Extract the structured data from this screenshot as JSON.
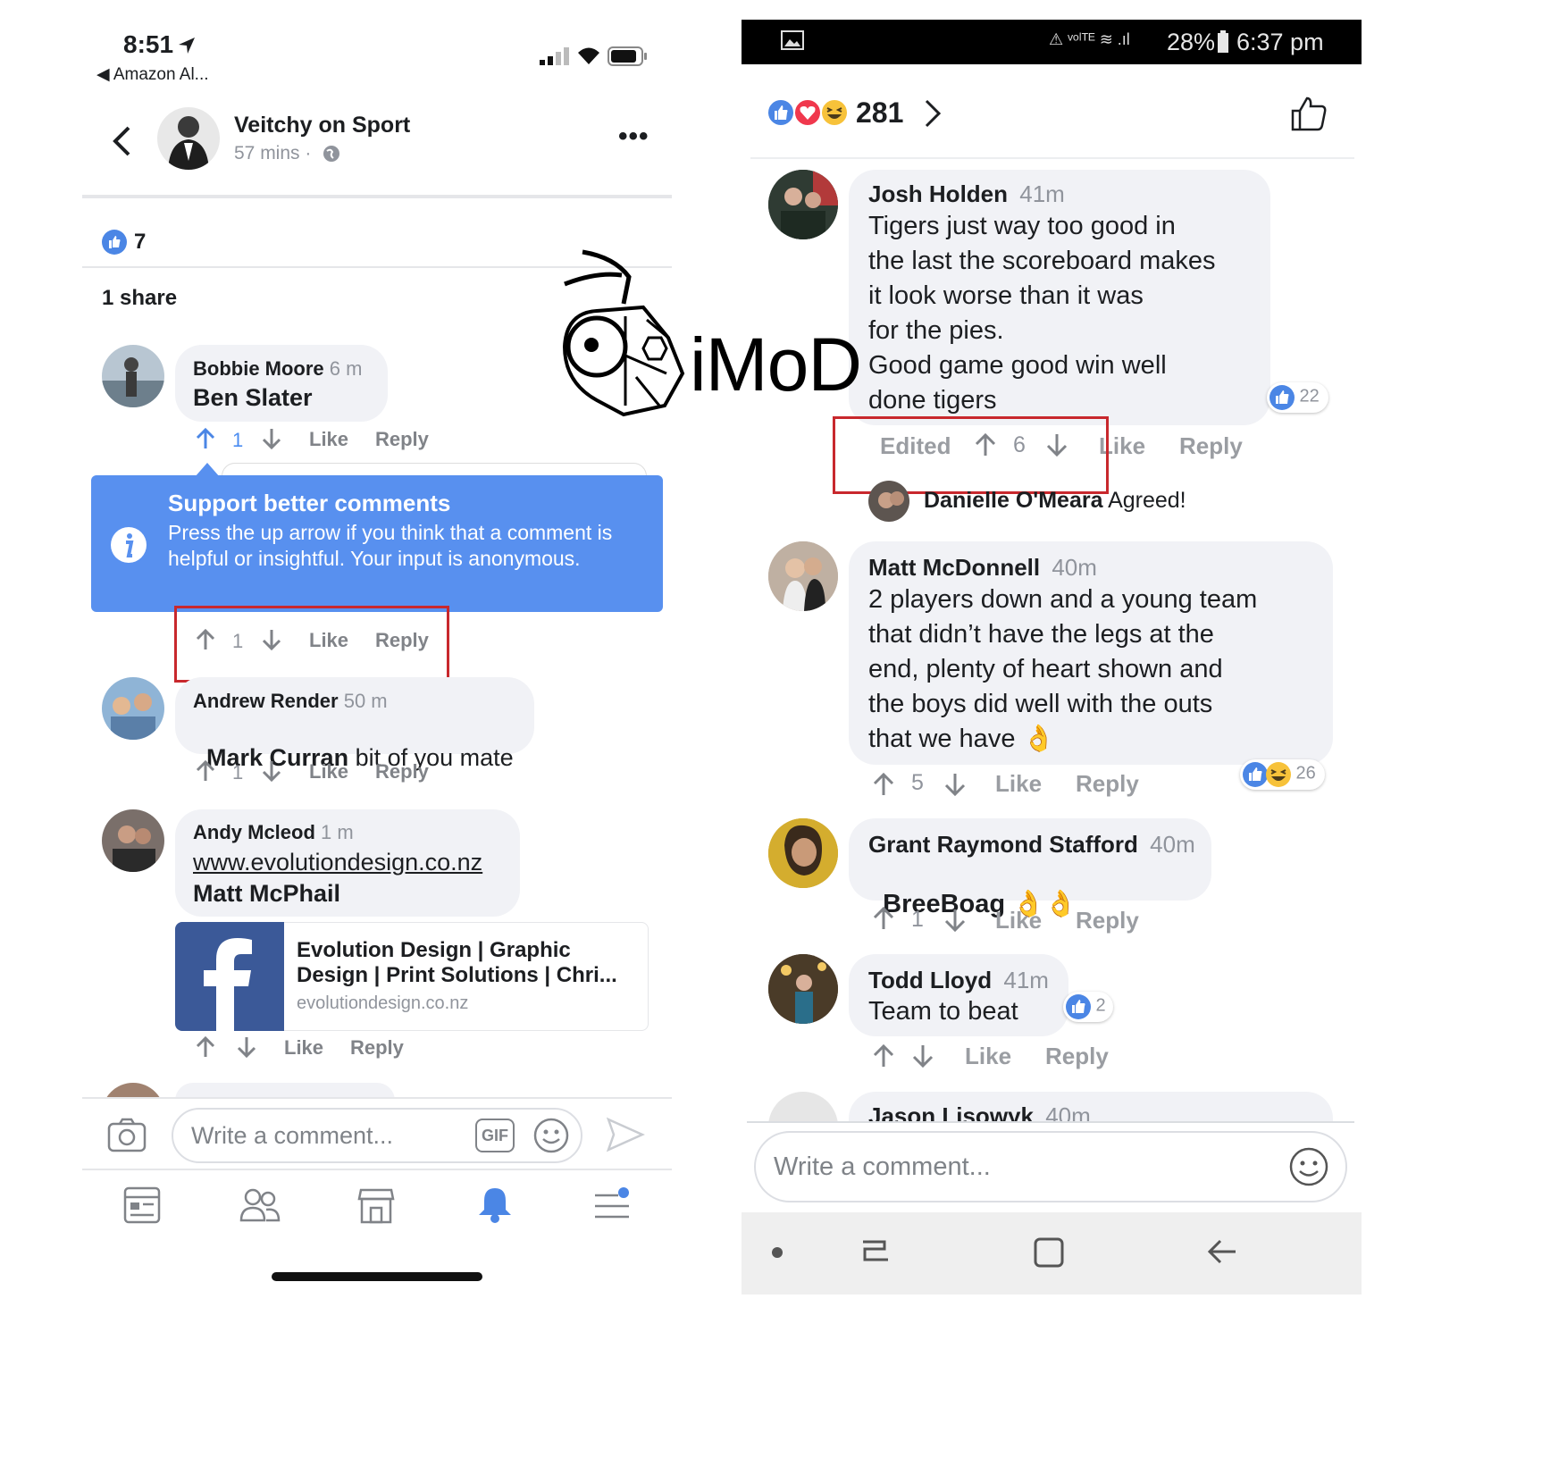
{
  "left": {
    "status": {
      "time": "8:51",
      "back_app": "Amazon Al..."
    },
    "post": {
      "name": "Veitchy on Sport",
      "meta": "57 mins ·"
    },
    "reactions_count": "7",
    "share_text": "1 share",
    "comments": [
      {
        "name": "Bobbie Moore",
        "time": "6 m",
        "text": "Ben Slater",
        "votes": "1"
      },
      {
        "votes": "1"
      },
      {
        "name": "Andrew Render",
        "time": "50 m",
        "mention": "Mark Curran",
        "text": " bit of you mate",
        "votes": "1"
      },
      {
        "name": "Andy Mcleod",
        "time": "1 m",
        "link": "www.evolutiondesign.co.nz",
        "text": "Matt McPhail"
      }
    ],
    "link_card": {
      "title": "Evolution Design | Graphic Design | Print Solutions | Chri...",
      "domain": "evolutiondesign.co.nz"
    },
    "tooltip": {
      "title": "Support better comments",
      "body": "Press the up arrow if you think that a comment is helpful or insightful. Your input is anonymous."
    },
    "actions": {
      "like": "Like",
      "reply": "Reply"
    },
    "composer": {
      "placeholder": "Write a comment...",
      "gif": "GIF"
    }
  },
  "right": {
    "status": {
      "battery": "28%",
      "time": "6:37 pm"
    },
    "reactions_total": "281",
    "comments": [
      {
        "name": "Josh Holden",
        "time": "41m",
        "text_lines": [
          "Tigers just way too good in",
          "the last the scoreboard makes",
          "it look worse than it was",
          "for the pies.",
          "Good game good win well",
          "done tigers"
        ],
        "reactions": "22",
        "edited": "Edited",
        "votes": "6"
      },
      {
        "name": "Matt McDonnell",
        "time": "40m",
        "text_lines": [
          "2 players down and a young team",
          "that didn’t have the legs at the",
          "end, plenty of heart shown and",
          "the boys did well with the outs",
          "that we have 👌"
        ],
        "reactions": "26",
        "votes": "5"
      },
      {
        "name": "Grant Raymond Stafford",
        "time": "40m",
        "mention": "BreeBoag",
        "emoji": "👌👌",
        "votes": "1"
      },
      {
        "name": "Todd Lloyd",
        "time": "41m",
        "text": "Team to beat",
        "reactions": "2"
      },
      {
        "name": "Jason Lisowyk",
        "time": "40m"
      }
    ],
    "reply_preview": {
      "name": "Danielle O'Meara",
      "text": "Agreed!"
    },
    "actions": {
      "like": "Like",
      "reply": "Reply"
    },
    "composer": {
      "placeholder": "Write a comment..."
    }
  },
  "watermark": {
    "text": "iMoD"
  },
  "colors": {
    "accent_blue": "#4b86e5",
    "tooltip_blue": "#5890ef",
    "highlight_red": "#c8282d",
    "link_card_blue": "#3b5998"
  }
}
